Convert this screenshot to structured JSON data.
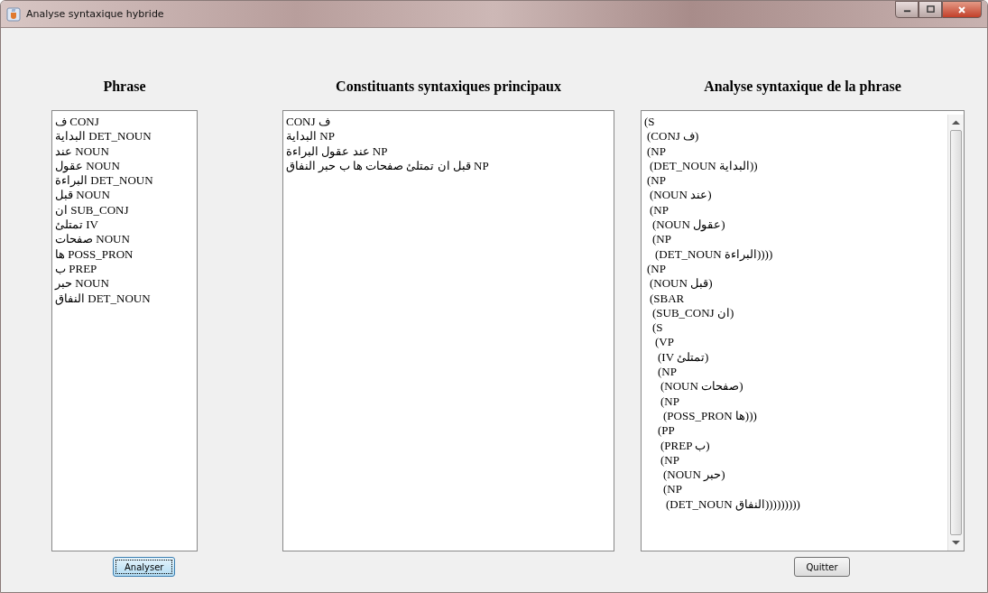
{
  "window": {
    "title": "Analyse syntaxique hybride"
  },
  "phrase_panel": {
    "heading": "Phrase",
    "lines": [
      "ف CONJ",
      "البداية DET_NOUN",
      "عند NOUN",
      "عقول NOUN",
      "البراءة DET_NOUN",
      "قبل NOUN",
      "ان SUB_CONJ",
      "تمتلئ IV",
      "صفحات NOUN",
      "ها POSS_PRON",
      "ب PREP",
      "حبر NOUN",
      "النفاق DET_NOUN"
    ]
  },
  "constituents_panel": {
    "heading": "Constituants syntaxiques principaux",
    "lines": [
      "CONJ ف",
      "البداية NP",
      "عند عقول البراءة NP",
      "قبل ان تمتلئ صفحات ها ب حبر النفاق NP"
    ]
  },
  "parse_panel": {
    "heading": "Analyse syntaxique de la phrase",
    "tree": {
      "text": "(S",
      "children": [
        {
          "text": "(CONJ ف)"
        },
        {
          "text": "(NP",
          "children": [
            {
              "text": "(DET_NOUN البداية))"
            }
          ]
        },
        {
          "text": "(NP",
          "children": [
            {
              "text": "(NOUN عند)"
            },
            {
              "text": "(NP",
              "children": [
                {
                  "text": "(NOUN عقول)"
                },
                {
                  "text": "(NP",
                  "children": [
                    {
                      "text": "(DET_NOUN البراءة))))"
                    }
                  ]
                }
              ]
            }
          ]
        },
        {
          "text": "(NP",
          "children": [
            {
              "text": "(NOUN قبل)"
            },
            {
              "text": "(SBAR",
              "children": [
                {
                  "text": "(SUB_CONJ ان)"
                },
                {
                  "text": "(S",
                  "children": [
                    {
                      "text": "(VP",
                      "children": [
                        {
                          "text": "(IV تمتلئ)"
                        },
                        {
                          "text": "(NP",
                          "children": [
                            {
                              "text": "(NOUN صفحات)"
                            },
                            {
                              "text": "(NP",
                              "children": [
                                {
                                  "text": "(POSS_PRON ها)))"
                                }
                              ]
                            }
                          ]
                        },
                        {
                          "text": "(PP",
                          "children": [
                            {
                              "text": "(PREP ب)"
                            },
                            {
                              "text": "(NP",
                              "children": [
                                {
                                  "text": "(NOUN حبر)"
                                },
                                {
                                  "text": "(NP",
                                  "children": [
                                    {
                                      "text": "(DET_NOUN النفاق)))))))))"
                                    }
                                  ]
                                }
                              ]
                            }
                          ]
                        }
                      ]
                    }
                  ]
                }
              ]
            }
          ]
        }
      ]
    }
  },
  "analyse_button": {
    "label": "Analyser",
    "focused": true
  },
  "quit_button": {
    "label": "Quitter",
    "focused": false
  }
}
